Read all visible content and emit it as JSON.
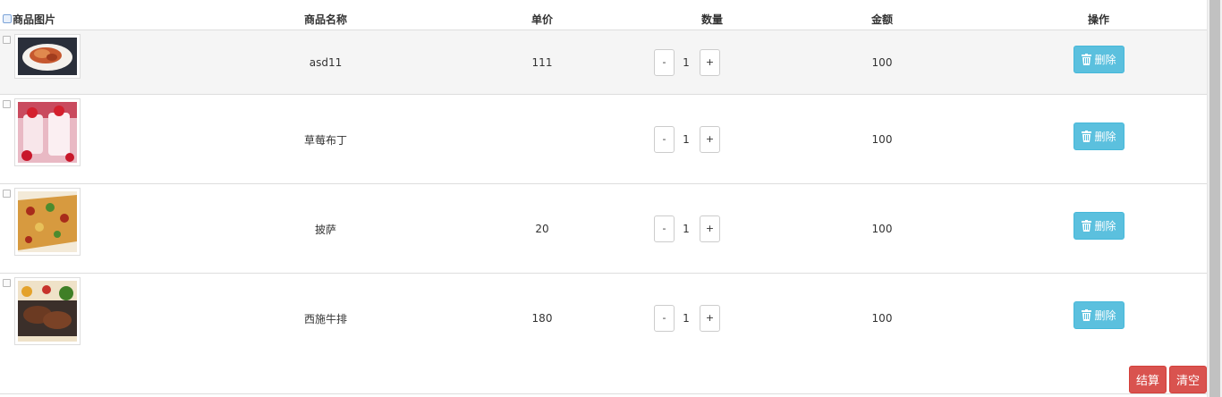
{
  "table": {
    "headers": {
      "image": "商品图片",
      "name": "商品名称",
      "price": "单价",
      "quantity": "数量",
      "amount": "金额",
      "action": "操作"
    },
    "rows": [
      {
        "image": "food-dish-image",
        "name": "asd11",
        "price": "111",
        "quantity": "1",
        "amount": "100",
        "delete_label": "删除",
        "minus": "-",
        "plus": "+"
      },
      {
        "image": "strawberry-pudding-image",
        "name": "草莓布丁",
        "price": "",
        "quantity": "1",
        "amount": "100",
        "delete_label": "删除",
        "minus": "-",
        "plus": "+"
      },
      {
        "image": "pizza-image",
        "name": "披萨",
        "price": "20",
        "quantity": "1",
        "amount": "100",
        "delete_label": "删除",
        "minus": "-",
        "plus": "+"
      },
      {
        "image": "steak-image",
        "name": "西施牛排",
        "price": "180",
        "quantity": "1",
        "amount": "100",
        "delete_label": "删除",
        "minus": "-",
        "plus": "+"
      }
    ]
  },
  "footer": {
    "checkout_label": "结算",
    "clear_label": "清空"
  },
  "colors": {
    "info": "#5bc0de",
    "danger": "#d9534f",
    "row_shaded": "#f5f5f5"
  },
  "icons": {
    "delete": "trash-icon"
  }
}
